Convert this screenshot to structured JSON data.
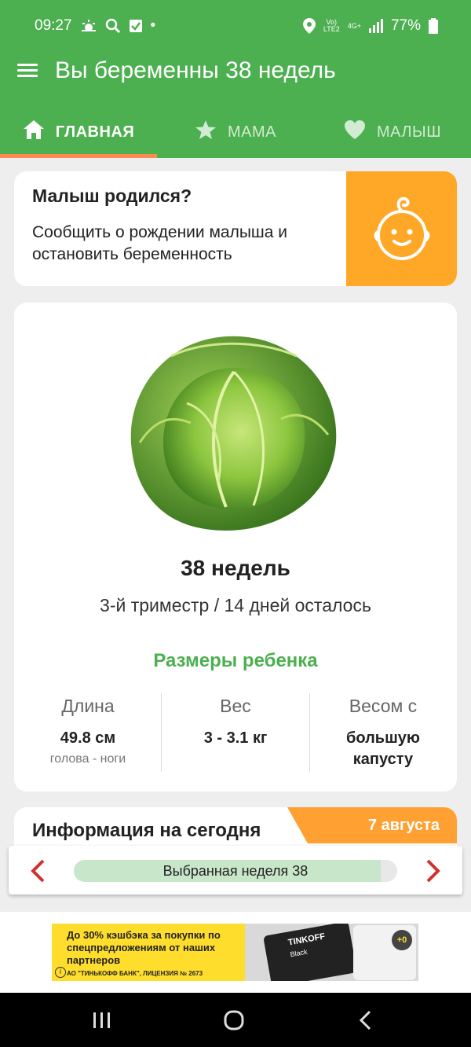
{
  "status_bar": {
    "time": "09:27",
    "dot": "•",
    "signal_volte": "Vo)",
    "signal_lte": "LTE2",
    "network": "4G+",
    "battery_percent": "77%",
    "icons": [
      "weather-icon",
      "search-icon",
      "check-icon",
      "location-icon",
      "signal-icon",
      "battery-icon"
    ]
  },
  "app_bar": {
    "title": "Вы беременны 38 недель"
  },
  "tabs": [
    {
      "label": "ГЛАВНАЯ",
      "icon": "home-icon",
      "active": true
    },
    {
      "label": "МАМА",
      "icon": "star-icon",
      "active": false
    },
    {
      "label": "МАЛЫШ",
      "icon": "heart-icon",
      "active": false
    }
  ],
  "born_card": {
    "title": "Малыш родился?",
    "text": "Сообщить о рождении малыша и остановить беременность",
    "icon": "baby-face-icon"
  },
  "week_card": {
    "fruit_icon": "cabbage-icon",
    "title": "38 недель",
    "subtitle": "3-й триместр / 14 дней осталось",
    "sizes_title": "Размеры ребенка",
    "sizes": [
      {
        "label": "Длина",
        "value": "49.8 см",
        "note": "голова - ноги"
      },
      {
        "label": "Вес",
        "value": "3 - 3.1 кг",
        "note": ""
      },
      {
        "label": "Весом с",
        "value": "большую капусту",
        "note": ""
      }
    ]
  },
  "info_card": {
    "title": "Информация на сегодня",
    "date": "7 августа"
  },
  "week_selector": {
    "label": "Выбранная неделя 38",
    "progress": 0.95
  },
  "ad": {
    "text": "До 30% кэшбэка за покупки по спецпредложениям от наших партнеров",
    "legal": "АО \"ТИНЬКОФФ БАНК\", ЛИЦЕНЗИЯ № 2673",
    "card_brand": "TINKOFF",
    "card_sub": "Black",
    "plus": "+0",
    "info": "i"
  },
  "colors": {
    "primary": "#4caf50",
    "accent_orange": "#ffa726",
    "tab_indicator": "#ff8a50",
    "arrow_red": "#d32f2f",
    "ad_yellow": "#ffdd2d"
  }
}
